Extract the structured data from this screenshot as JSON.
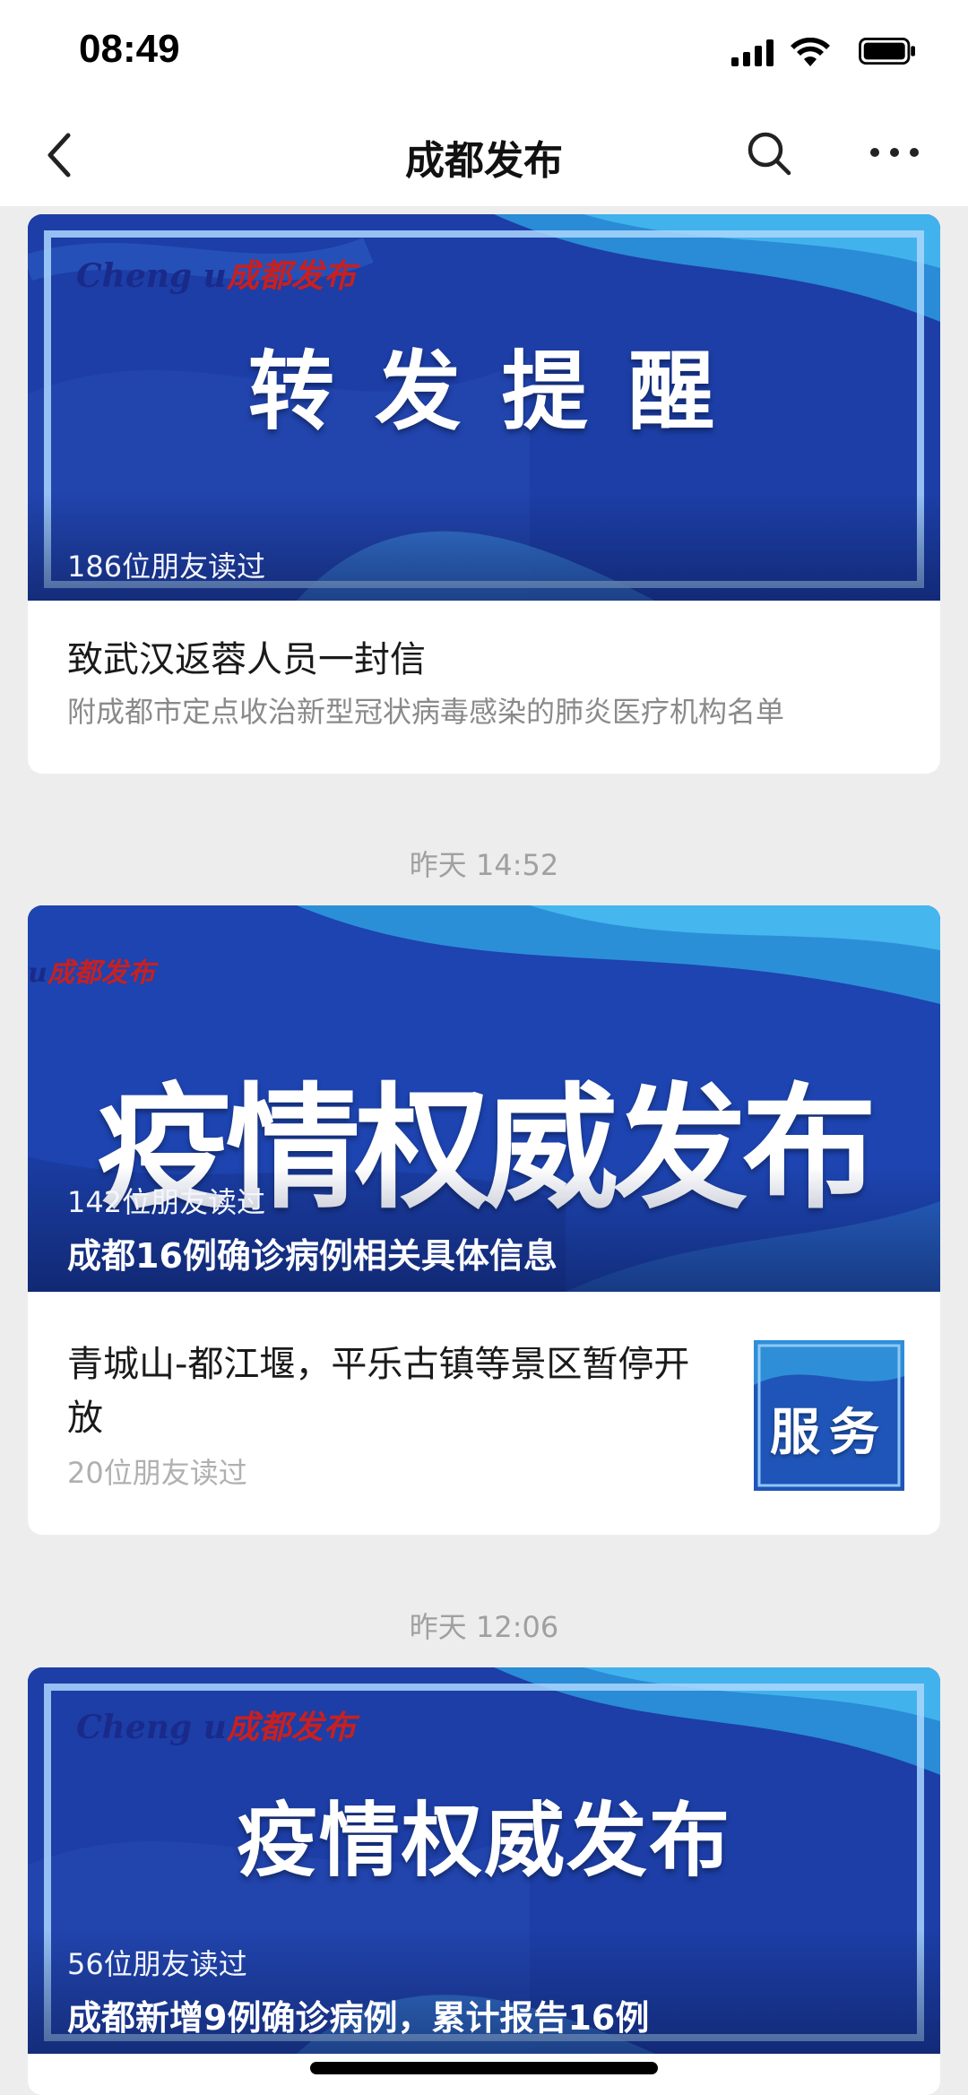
{
  "status_bar": {
    "time": "08:49"
  },
  "nav": {
    "title": "成都发布"
  },
  "articles": [
    {
      "cover_headline": "转 发 提 醒",
      "reads": "186位朋友读过",
      "title": "致武汉返蓉人员一封信",
      "subtitle": "附成都市定点收治新型冠状病毒感染的肺炎医疗机构名单",
      "logo_en": "Cheng  u",
      "logo_cn": "成都发布"
    },
    {
      "timestamp": "昨天 14:52",
      "cover_headline": "疫情权威发布",
      "reads": "142位朋友读过",
      "cover_title": "成都16例确诊病例相关具体信息",
      "logo_en": "u",
      "logo_cn": "成都发布",
      "title": "青城山-都江堰，平乐古镇等景区暂停开放",
      "sub_reads": "20位朋友读过",
      "thumb_text": "服务"
    },
    {
      "timestamp": "昨天 12:06",
      "cover_headline": "疫情权威发布",
      "reads": "56位朋友读过",
      "cover_title": "成都新增9例确诊病例，累计报告16例",
      "logo_en": "Cheng  u",
      "logo_cn": "成都发布"
    }
  ],
  "colors": {
    "cover_blue": "#1a3fa8",
    "frame": "#aad7ff",
    "logo_red": "#c82020"
  }
}
